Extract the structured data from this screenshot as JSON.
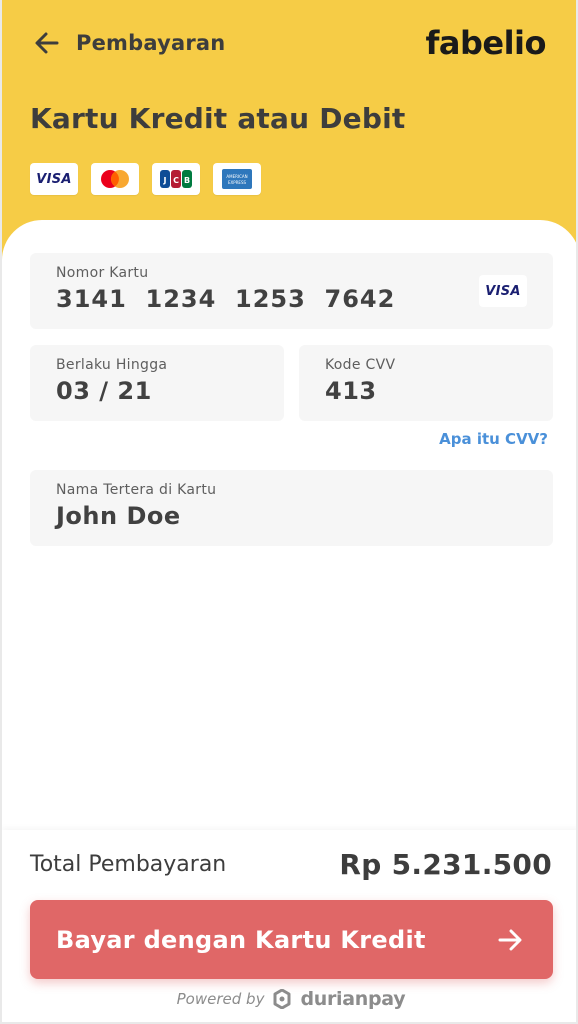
{
  "header": {
    "back_icon": "arrow-left-icon",
    "back_label": "Pembayaran",
    "logo": "fabelio"
  },
  "page_title": "Kartu Kredit atau Debit",
  "accepted_cards": {
    "visa": "VISA",
    "mastercard": "mastercard",
    "jcb": "JCB",
    "amex": "AMERICAN EXPRESS"
  },
  "form": {
    "card_number": {
      "label": "Nomor Kartu",
      "value": "3141  1234  1253  7642",
      "brand": "VISA"
    },
    "expiry": {
      "label": "Berlaku Hingga",
      "value": "03 / 21"
    },
    "cvv": {
      "label": "Kode CVV",
      "value": "413",
      "help_link": "Apa itu CVV?"
    },
    "name": {
      "label": "Nama Tertera di Kartu",
      "value": "John Doe"
    }
  },
  "footer": {
    "total_label": "Total Pembayaran",
    "total_amount": "Rp 5.231.500",
    "pay_button_label": "Bayar dengan Kartu Kredit",
    "pay_button_icon": "arrow-right-icon",
    "powered_by": "Powered by",
    "provider": "durianpay"
  },
  "colors": {
    "header_bg": "#f6cc46",
    "primary_button": "#e06767",
    "link": "#4a90d9",
    "field_bg": "#f6f6f6"
  }
}
